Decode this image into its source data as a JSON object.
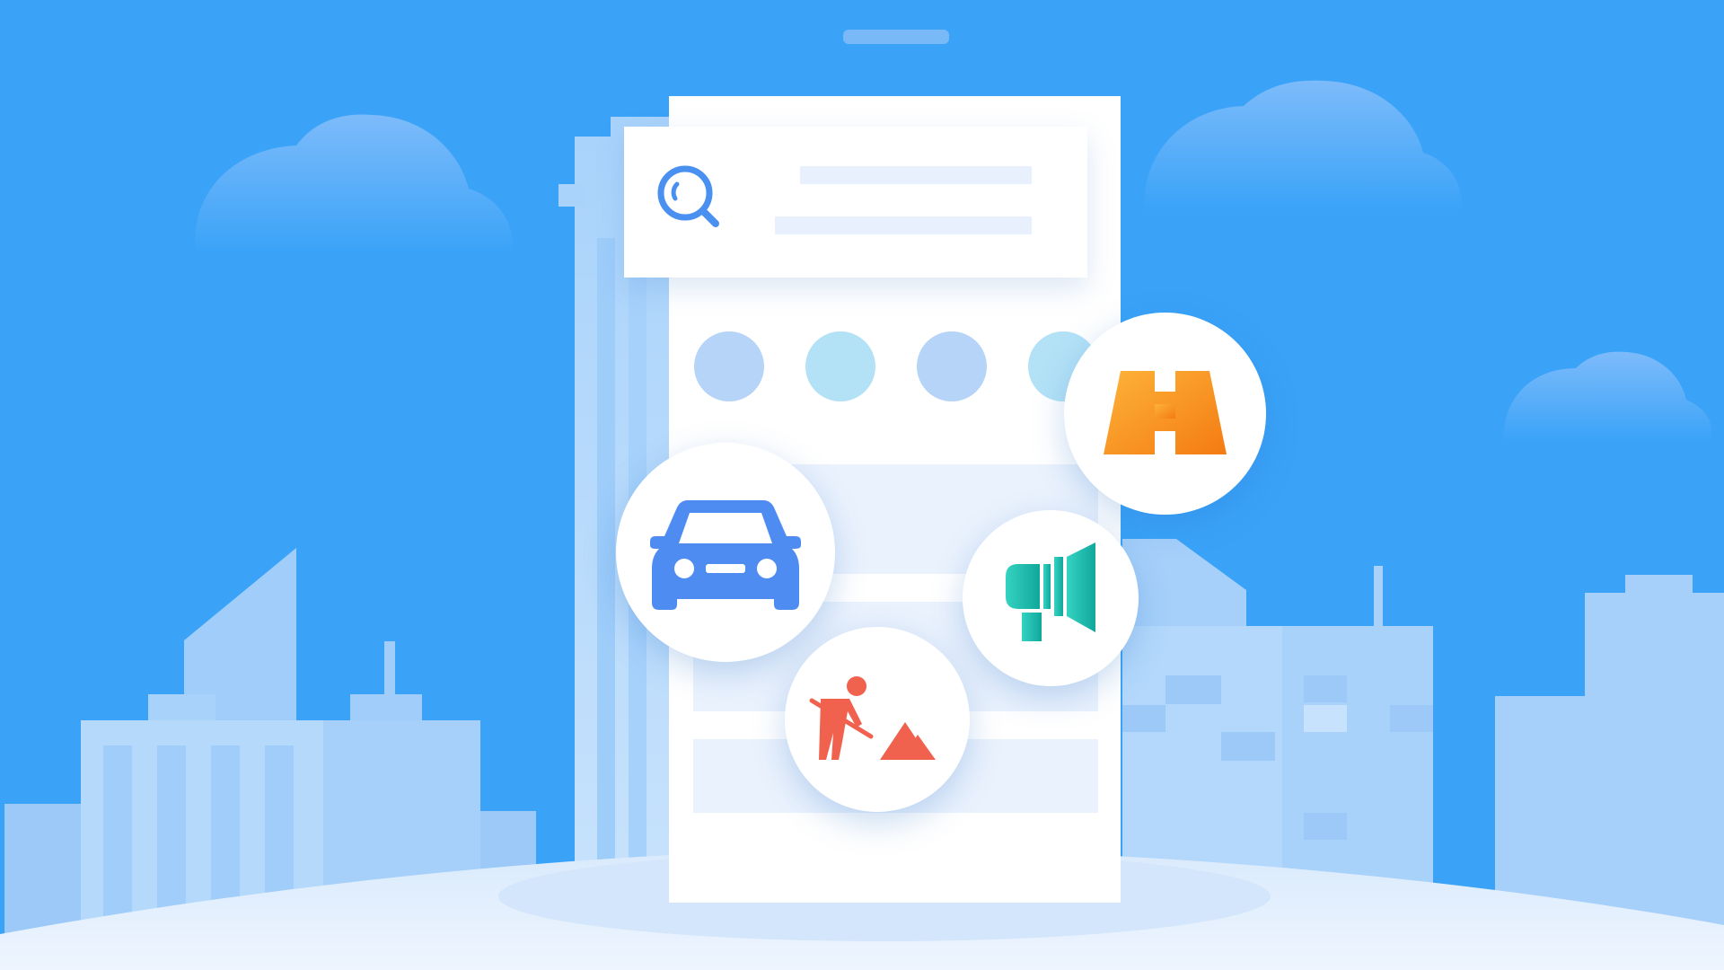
{
  "scene": {
    "colors": {
      "sky": "#3AA3F8",
      "cloud": "#71B4F8",
      "building_light": "#B8DAFB",
      "building_mid": "#9FCBF9",
      "ground": "#E3EFFC",
      "phone": "#FFFFFF",
      "search_icon": "#4A90F0",
      "car": "#4F8CF2",
      "road": "#F7921E",
      "megaphone": "#1FC5B3",
      "worker": "#F0624D"
    },
    "icons": [
      "search-icon",
      "car-icon",
      "road-icon",
      "megaphone-icon",
      "road-work-icon"
    ]
  }
}
